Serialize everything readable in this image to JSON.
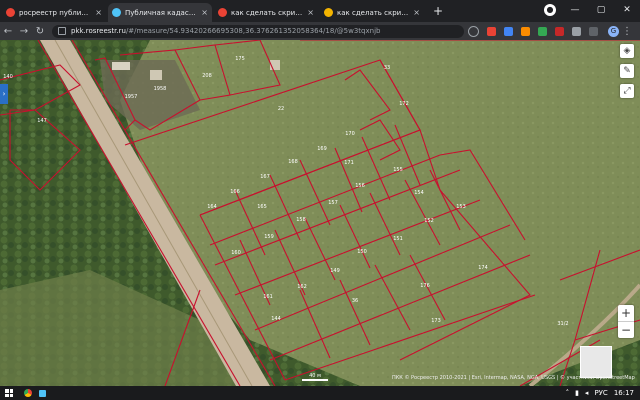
{
  "browser": {
    "tabs": [
      {
        "title": "росреестр публичная кадастро",
        "icon_color": "#ea4335",
        "active": false
      },
      {
        "title": "Публичная кадастровая карта",
        "icon_color": "#4fc3f7",
        "active": true
      },
      {
        "title": "как сделать скрин экрана на н",
        "icon_color": "#ea4335",
        "active": false
      },
      {
        "title": "как сделать скрин экрана на н",
        "icon_color": "#f4b400",
        "active": false
      }
    ],
    "close_glyph": "×",
    "newtab_glyph": "+",
    "url_host": "pkk.rosreestr.ru",
    "url_rest": "/#/measure/54.93420266695308,36.376261352058364/18/@5w3tqxnjb",
    "profile_initial": "G"
  },
  "map": {
    "colors": {
      "parcel": "#c8102e",
      "field": "#7f8d58",
      "forest": "#3f5a2c",
      "road": "#c9b8a0"
    },
    "parcel_labels": [
      {
        "text": "140"
      },
      {
        "text": "147"
      },
      {
        "text": "1957"
      },
      {
        "text": "1958"
      },
      {
        "text": "208"
      },
      {
        "text": "175"
      },
      {
        "text": "33"
      },
      {
        "text": "22"
      },
      {
        "text": "172"
      },
      {
        "text": "171"
      },
      {
        "text": "170"
      },
      {
        "text": "169"
      },
      {
        "text": "168"
      },
      {
        "text": "167"
      },
      {
        "text": "166"
      },
      {
        "text": "164"
      },
      {
        "text": "165"
      },
      {
        "text": "157"
      },
      {
        "text": "156"
      },
      {
        "text": "155"
      },
      {
        "text": "154"
      },
      {
        "text": "153"
      },
      {
        "text": "152"
      },
      {
        "text": "151"
      },
      {
        "text": "150"
      },
      {
        "text": "149"
      },
      {
        "text": "160"
      },
      {
        "text": "159"
      },
      {
        "text": "158"
      },
      {
        "text": "162"
      },
      {
        "text": "161"
      },
      {
        "text": "176"
      },
      {
        "text": "174"
      },
      {
        "text": "173"
      },
      {
        "text": "36"
      },
      {
        "text": "144"
      },
      {
        "text": "31/2"
      }
    ],
    "scale_label": "40 м",
    "attribution": "ПКК © Росреестр 2010-2021 | Esri, Intermap, NASA, NGA, USGS | © участники OpenStreetMap"
  },
  "taskbar": {
    "lang": "РУС",
    "time": "16:17"
  }
}
